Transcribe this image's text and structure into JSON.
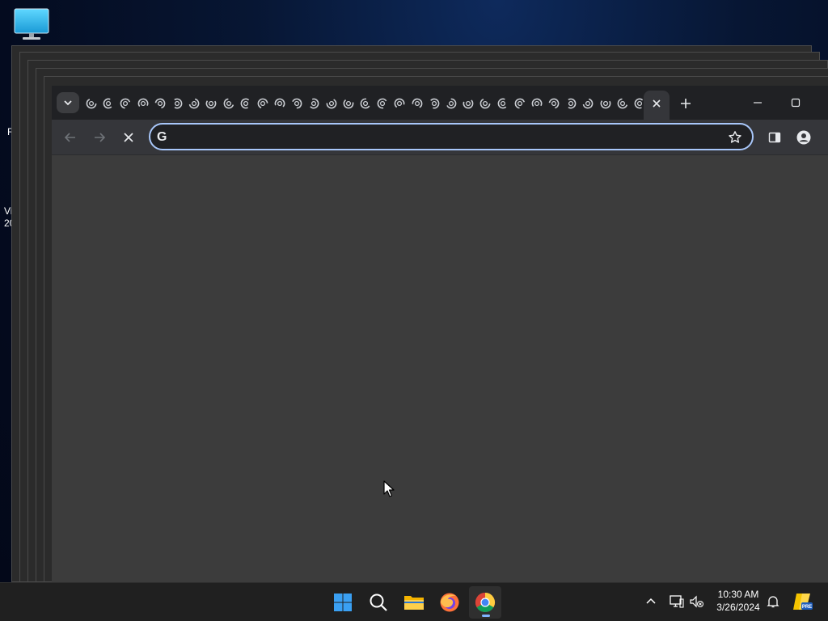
{
  "desktop": {
    "icon_name": "monitor-icon",
    "partial_labels": [
      "R",
      "Vi",
      "20"
    ]
  },
  "browser": {
    "tab_favicon_icon": "chrome-loading-spinner-icon",
    "tab_count_visible": 33,
    "tab_search_icon": "chevron-down-icon",
    "active_tab_close_icon": "close-icon",
    "new_tab_icon": "plus-icon",
    "window_controls": [
      "minimize-icon",
      "maximize-icon"
    ],
    "toolbar": {
      "back_icon": "arrow-left-icon",
      "forward_icon": "arrow-right-icon",
      "stop_icon": "close-icon",
      "side_panel_icon": "side-panel-icon",
      "profile_icon": "profile-icon"
    },
    "omnibox": {
      "provider_glyph": "G",
      "value": "",
      "placeholder": "",
      "bookmark_icon": "star-icon"
    },
    "colors": {
      "tabstrip": "#202124",
      "toolbar": "#35363a",
      "omnibox_border": "#a8c7fa",
      "content": "#3c3c3c"
    }
  },
  "taskbar": {
    "apps": [
      "windows-start-icon",
      "search-icon",
      "file-explorer-icon",
      "firefox-icon",
      "chrome-icon"
    ],
    "running_app": "chrome-icon",
    "tray": [
      "chevron-up-icon",
      "network-icon",
      "volume-muted-icon"
    ],
    "time": "10:30 AM",
    "date": "3/26/2024",
    "notification_icon": "bell-icon",
    "copilot_badge": "PRE"
  }
}
